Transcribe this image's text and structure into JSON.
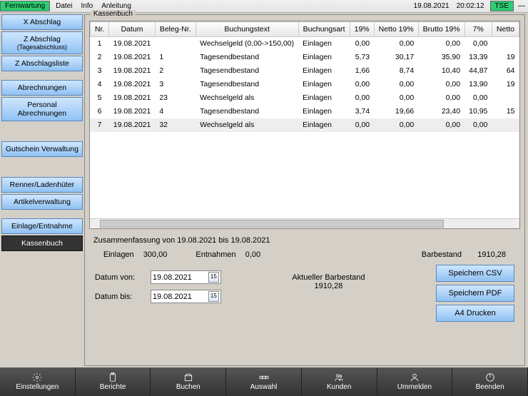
{
  "menubar": {
    "remote": "Fernwartung",
    "items": [
      "Datei",
      "Info",
      "Anleitung"
    ],
    "date": "19.08.2021",
    "time": "20:02:12",
    "tse": "TSE"
  },
  "sidebar": {
    "x_abschlag": "X Abschlag",
    "z_abschlag": "Z Abschlag",
    "z_abschlag_sub": "(Tagesabschluss)",
    "z_liste": "Z Abschlagsliste",
    "abrechnungen": "Abrechnungen",
    "personal": "Personal Abrechnungen",
    "gutschein": "Gutschein Verwaltung",
    "renner": "Renner/Ladenhüter",
    "artikel": "Artikelverwaltung",
    "einlage": "Einlage/Entnahme",
    "kassenbuch": "Kassenbuch"
  },
  "group": {
    "title": "Kassenbuch"
  },
  "table": {
    "headers": [
      "Nr.",
      "Datum",
      "Beleg-Nr.",
      "Buchungstext",
      "Buchungsart",
      "19%",
      "Netto 19%",
      "Brutto 19%",
      "7%",
      "Netto"
    ],
    "rows": [
      {
        "nr": "1",
        "datum": "19.08.2021",
        "beleg": "",
        "text": "Wechselgeld (0,00->150,00)",
        "art": "Einlagen",
        "p19": "0,00",
        "n19": "0,00",
        "b19": "0,00",
        "p7": "0,00",
        "n7": ""
      },
      {
        "nr": "2",
        "datum": "19.08.2021",
        "beleg": "1",
        "text": "Tagesendbestand",
        "art": "Einlagen",
        "p19": "5,73",
        "n19": "30,17",
        "b19": "35,90",
        "p7": "13,39",
        "n7": "19"
      },
      {
        "nr": "3",
        "datum": "19.08.2021",
        "beleg": "2",
        "text": "Tagesendbestand",
        "art": "Einlagen",
        "p19": "1,66",
        "n19": "8,74",
        "b19": "10,40",
        "p7": "44,87",
        "n7": "64"
      },
      {
        "nr": "4",
        "datum": "19.08.2021",
        "beleg": "3",
        "text": "Tagesendbestand",
        "art": "Einlagen",
        "p19": "0,00",
        "n19": "0,00",
        "b19": "0,00",
        "p7": "13,90",
        "n7": "19"
      },
      {
        "nr": "5",
        "datum": "19.08.2021",
        "beleg": "23",
        "text": "Wechselgeld als",
        "art": "Einlagen",
        "p19": "0,00",
        "n19": "0,00",
        "b19": "0,00",
        "p7": "0,00",
        "n7": ""
      },
      {
        "nr": "6",
        "datum": "19.08.2021",
        "beleg": "4",
        "text": "Tagesendbestand",
        "art": "Einlagen",
        "p19": "3,74",
        "n19": "19,66",
        "b19": "23,40",
        "p7": "10,95",
        "n7": "15"
      },
      {
        "nr": "7",
        "datum": "19.08.2021",
        "beleg": "32",
        "text": "Wechselgeld als",
        "art": "Einlagen",
        "p19": "0,00",
        "n19": "0,00",
        "b19": "0,00",
        "p7": "0,00",
        "n7": ""
      }
    ]
  },
  "summary": {
    "title": "Zusammenfassung von 19.08.2021 bis 19.08.2021",
    "einlagen_label": "Einlagen",
    "einlagen_value": "300,00",
    "entnahmen_label": "Entnahmen",
    "entnahmen_value": "0,00",
    "barbestand_label": "Barbestand",
    "barbestand_value": "1910,28"
  },
  "dates": {
    "from_label": "Datum von:",
    "to_label": "Datum bis:",
    "from_value": "19.08.2021",
    "to_value": "19.08.2021"
  },
  "current": {
    "label": "Aktueller Barbestand",
    "value": "1910,28"
  },
  "actions": {
    "csv": "Speichern CSV",
    "pdf": "Speichern PDF",
    "print": "A4 Drucken"
  },
  "bottombar": {
    "einstellungen": "Einstellungen",
    "berichte": "Berichte",
    "buchen": "Buchen",
    "auswahl": "Auswahl",
    "kunden": "Kunden",
    "ummelden": "Ummelden",
    "beenden": "Beenden"
  }
}
